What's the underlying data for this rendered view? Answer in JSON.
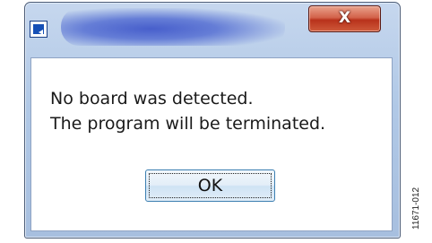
{
  "dialog": {
    "app_icon": "analog-devices-logo-icon",
    "close_button": {
      "label": "X",
      "icon": "close-icon"
    },
    "message_lines": [
      "No board was detected.",
      "The program will be terminated."
    ],
    "ok_button": {
      "label": "OK"
    }
  },
  "figure_id": "11671-012",
  "colors": {
    "title_accent": "#3a52c8",
    "close_red": "#c9452b",
    "ok_border": "#3c7fb1",
    "frame": "#b0c8e6"
  }
}
